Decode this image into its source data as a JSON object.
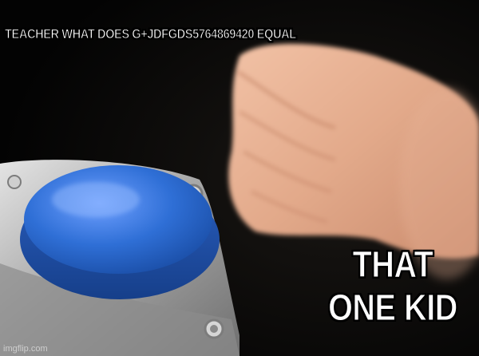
{
  "meme": {
    "top_caption": "TEACHER WHAT DOES G+JDFGDS5764869420 EQUAL",
    "bottom_caption": "THAT ONE KID",
    "watermark": "imgflip.com"
  },
  "colors": {
    "background": "#050505",
    "button_blue": "#2f6fd6",
    "metal_housing": "#b8b8b8",
    "skin": "#e2a98a",
    "caption_text": "#ffffff",
    "caption_outline": "#000000"
  },
  "icons": {
    "button": "big-blue-button-icon",
    "hand": "slapping-hand-icon"
  }
}
